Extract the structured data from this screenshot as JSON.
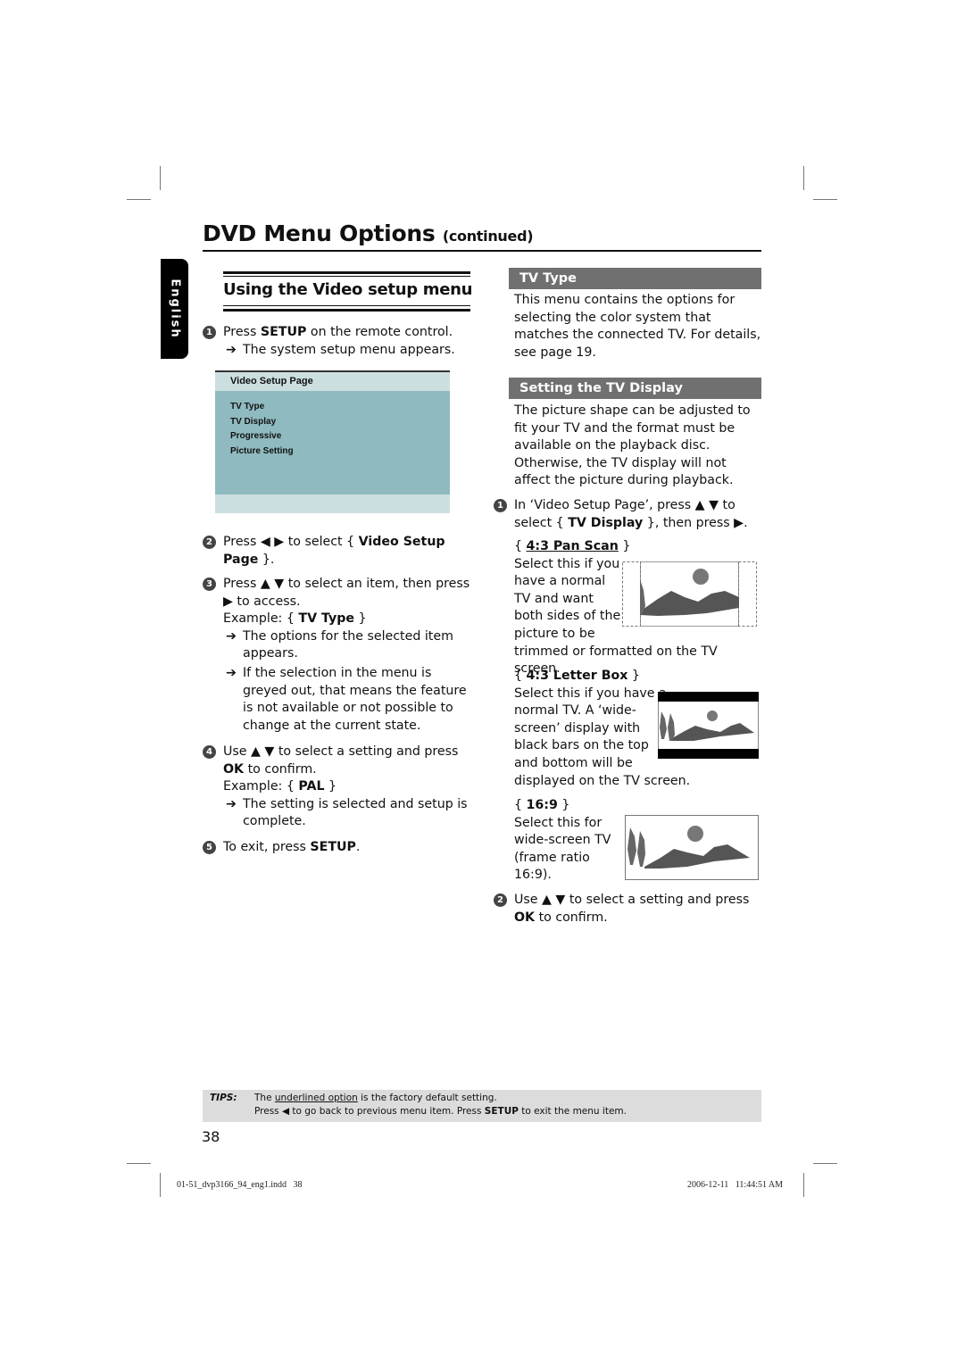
{
  "header": {
    "title": "DVD Menu Options",
    "title_suffix": "(continued)",
    "language_tab": "English"
  },
  "left_column": {
    "section_title": "Using the Video setup menu",
    "steps": [
      {
        "num": "1",
        "pre": "Press ",
        "bold": "SETUP",
        "post": " on the remote control.",
        "results": [
          "The system setup menu appears."
        ]
      },
      {
        "num": "2",
        "line1_pre": "Press ◀ ▶ to select { ",
        "line1_bold": "Video Setup",
        "line2_bold": "Page",
        "line2_post": " }."
      },
      {
        "num": "3",
        "line1": "Press ▲ ▼ to select an item, then press",
        "line2": "▶ to access.",
        "example_pre": "Example: { ",
        "example_bold": "TV Type",
        "example_post": " }",
        "results": [
          "The options for the selected item appears.",
          "If the selection in the menu is greyed out, that means the feature is not available or not possible to change at the current state."
        ]
      },
      {
        "num": "4",
        "line1": "Use ▲ ▼ to select a setting and press",
        "line2_bold": "OK",
        "line2_post": " to confirm.",
        "example_pre": "Example: { ",
        "example_bold": "PAL",
        "example_post": " }",
        "results": [
          "The setting is selected and setup is complete."
        ]
      },
      {
        "num": "5",
        "pre": "To exit, press ",
        "bold": "SETUP",
        "post": "."
      }
    ],
    "menu_screenshot": {
      "title": "Video Setup Page",
      "items": [
        "TV Type",
        "TV Display",
        "Progressive",
        "Picture Setting"
      ]
    }
  },
  "right_column": {
    "tv_type": {
      "heading": "TV Type",
      "body": "This menu contains the options for selecting the color system that matches the connected TV. For details, see page 19."
    },
    "tv_display": {
      "heading": "Setting the TV Display",
      "body": "The picture shape can be adjusted to fit your TV and the format must be available on the playback disc. Otherwise, the TV display will not affect the picture during playback.",
      "step1": {
        "num": "1",
        "line1": "In ‘Video Setup Page’, press ▲ ▼ to",
        "line2_pre": "select { ",
        "line2_bold": "TV Display",
        "line2_post": " }, then press ▶."
      },
      "options": [
        {
          "label": "4:3 Pan Scan",
          "is_default": true,
          "lines": [
            "Select this if you",
            "have a normal",
            "TV and want",
            "both sides of the",
            "picture to be"
          ],
          "tail": "trimmed or formatted on the TV screen.",
          "illustration": "pan-scan-illustration"
        },
        {
          "label": "4:3 Letter Box",
          "is_default": false,
          "lines": [
            "Select this if you have a",
            "normal TV. A  ‘wide-",
            "screen’ display with",
            "black bars on the top",
            "and bottom will be"
          ],
          "tail": "displayed on the TV screen.",
          "illustration": "letterbox-illustration"
        },
        {
          "label": "16:9",
          "is_default": false,
          "lines": [
            "Select this for",
            "wide-screen TV",
            "(frame ratio",
            "16:9)."
          ],
          "tail": "",
          "illustration": "widescreen-illustration"
        }
      ],
      "step2": {
        "num": "2",
        "line1": "Use ▲ ▼ to select a setting and press",
        "line2_bold": "OK",
        "line2_post": " to confirm."
      }
    }
  },
  "tips": {
    "label": "TIPS:",
    "line1_pre": "The ",
    "line1_underlined": "underlined option",
    "line1_post": " is the factory default setting.",
    "line2_pre": "Press  ◀ to go back to previous menu item. Press ",
    "line2_bold": "SETUP",
    "line2_post": " to exit the menu item."
  },
  "footer": {
    "page_number": "38",
    "file_slug": "01-51_dvp3166_94_eng1.indd   38",
    "timestamp": "2006-12-11   11:44:51 AM"
  },
  "colors": {
    "section_header_bg": "#707070",
    "menu_header_bg": "#ccdfe0",
    "menu_body_bg": "#8fbac0",
    "tips_bg": "#dcdcdc"
  }
}
